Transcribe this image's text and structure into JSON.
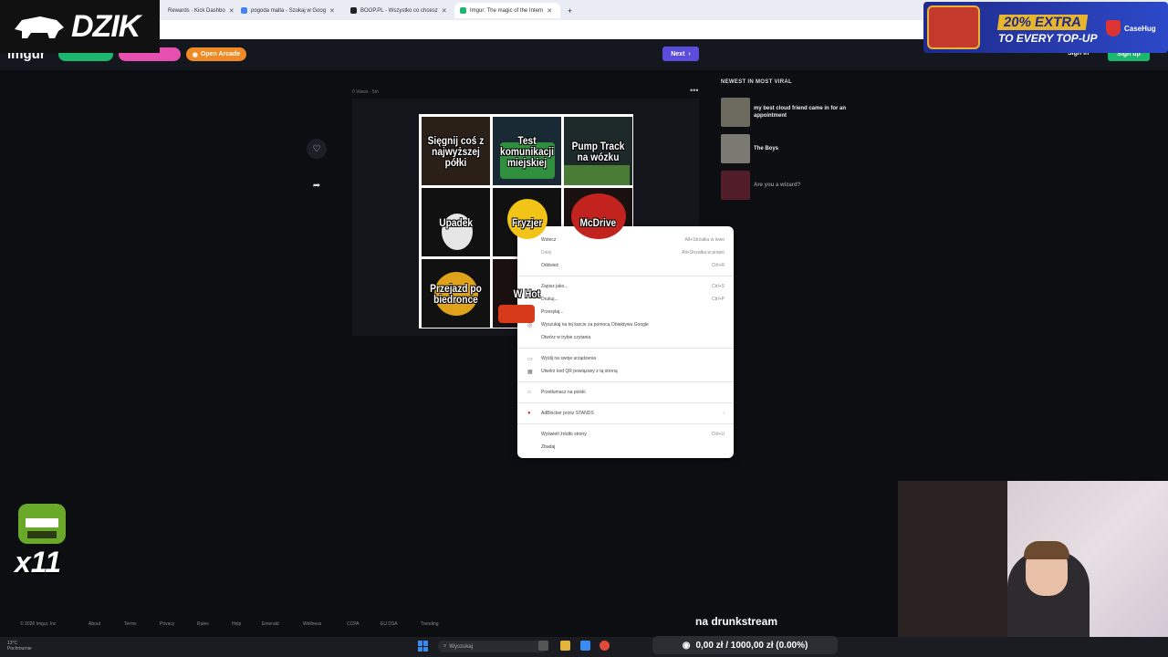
{
  "browser": {
    "tabs": [
      {
        "label": "Rewards · Kick Dashbo"
      },
      {
        "label": "pogoda malta - Szukaj w Goog"
      },
      {
        "label": "BOOP.PL - Wszystko co chcesz"
      },
      {
        "label": "Imgur: The magic of the Intern"
      }
    ],
    "new_tab": "+"
  },
  "overlay": {
    "logo": "DZIK",
    "ad_line1": "20% EXTRA",
    "ad_line2": "TO EVERY TOP-UP",
    "ad_brand": "CaseHug",
    "mascot_count": "x11",
    "stream_label": "na drunkstream",
    "counter": "0,00 zł / 1000,00 zł (0.00%)"
  },
  "header": {
    "logo": "imgur",
    "open_arcade": "Open Arcade",
    "next": "Next",
    "sign_in": "Sign in",
    "sign_up": "Sign up"
  },
  "post": {
    "meta": "0 Views · 5m",
    "cells": [
      "Sięgnij coś z najwyższej półki",
      "Test komunikacji miejskiej",
      "Pump Track na wózku",
      "Upadek",
      "Fryzjer",
      "McDrive",
      "Przejazd po biedronce",
      "W Hot",
      ""
    ]
  },
  "sidebar": {
    "title": "NEWEST IN MOST VIRAL",
    "items": [
      {
        "text": "my best cloud friend came in for an appointment"
      },
      {
        "text": "The Boys"
      },
      {
        "text": "Are you a wizard?"
      }
    ]
  },
  "context_menu": {
    "items": [
      {
        "label": "Wstecz",
        "shortcut": "Alt+Strzałka w lewo"
      },
      {
        "label": "Dalej",
        "shortcut": "Alt+Strzałka w prawo"
      },
      {
        "label": "Odśwież",
        "shortcut": "Ctrl+R"
      },
      {
        "label": "Zapisz jako...",
        "shortcut": "Ctrl+S"
      },
      {
        "label": "Drukuj...",
        "shortcut": "Ctrl+P"
      },
      {
        "label": "Przesyłaj...",
        "shortcut": ""
      },
      {
        "label": "Wyszukaj na tej karcie za pomocą Obiektywu Google",
        "shortcut": ""
      },
      {
        "label": "Otwórz w trybie czytania",
        "shortcut": ""
      },
      {
        "label": "Wyślij na swoje urządzenia",
        "shortcut": ""
      },
      {
        "label": "Utwórz kod QR powiązany z tą stroną",
        "shortcut": ""
      },
      {
        "label": "Przetłumacz na polski",
        "shortcut": ""
      },
      {
        "label": "AdBlocker przez STANDS",
        "shortcut": "›"
      },
      {
        "label": "Wyświetl źródło strony",
        "shortcut": "Ctrl+U"
      },
      {
        "label": "Zbadaj",
        "shortcut": ""
      }
    ]
  },
  "footer": {
    "links": [
      "© 2026 Imgur, Inc",
      "About",
      "Terms",
      "Privacy",
      "Rules",
      "Help",
      "Emerald",
      "Wellness",
      "CCPA",
      "EU DSA",
      "Trending"
    ]
  },
  "taskbar": {
    "weather_temp": "13°C",
    "weather_desc": "Pochmurnie",
    "search_placeholder": "Wyszukaj"
  }
}
